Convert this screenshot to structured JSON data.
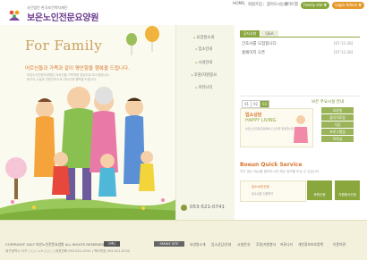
{
  "header": {
    "org_subtitle": "사단법인 한국보건복지재단",
    "logo_name": "보은노인전문요양원",
    "nav": [
      "HOME",
      "회원가입",
      "찾아오시는길",
      "사이트맵"
    ],
    "pill_green": "Family site ▼",
    "pill_orange": "Login Admin ▼"
  },
  "hero": {
    "title": "For Family",
    "subtitle": "어르신들과 가족과 같이 평안함을 행복을 드립니다.",
    "line2": "보은노인전문요양원은 어르신을 가족처럼 정성으로 모시겠습니다.",
    "line3": "최고의 시설과 전문인력으로 어르신께 행복을 드립니다."
  },
  "submenu": {
    "items": [
      "요양원소개",
      "입소안내",
      "시설안내",
      "후원/자원봉사",
      "커뮤니티"
    ],
    "phone": "053-521-0741"
  },
  "content": {
    "tabs": [
      "공지사항",
      "Q&A"
    ],
    "notices": [
      {
        "title": "간호사를 모집합니다.",
        "date": "[07-11-26]"
      },
      {
        "title": "홈페이지 오픈",
        "date": "[07-11-26]"
      }
    ],
    "pager": [
      "01",
      "02",
      "03"
    ],
    "guide_title": "보은 주요시설 안내",
    "guide_buttons": [
      "요양실",
      "물리치료실",
      "식당",
      "프로그램실",
      "목욕실",
      "세탁실"
    ],
    "consult": {
      "label": "입소상담",
      "slogan": "HAPPY LIVING",
      "desc": "보은노인전문요양원에 오신것을 환영합니다."
    },
    "quick_title": "Boeun Quick Service",
    "quick_sub": "자주 찾는 메뉴를 클릭하시면 해당 정보를 보실 수 있습니다.",
    "quick_items": [
      {
        "label": "입소상담신청",
        "desc": "입소상담 신청하기"
      },
      {
        "label": "후원신청",
        "desc": ""
      },
      {
        "label": "자원봉사신청",
        "desc": ""
      }
    ]
  },
  "footer": {
    "copyright": "COPYRIGHT 2007 보은노인전문요양원 ALL RIGHTS RESERVED.",
    "family_label": "가족1",
    "address": "대구광역시 서구 ○○○ 1-9 ○○○ | 대표전화 053-521-0741 | 팩스번호 053-521-0742",
    "family_site_btn": "FAMILY SITE",
    "links": [
      "요양원소개",
      "입소상담/안내",
      "시설안내",
      "후원/자원봉사",
      "커뮤니티",
      "개인정보보호정책",
      "이용약관"
    ]
  },
  "colors": {
    "brand_purple": "#6b3b8e",
    "accent_orange": "#d7742c",
    "accent_green": "#8aa73e",
    "hero_bg": "#fbfaee"
  }
}
